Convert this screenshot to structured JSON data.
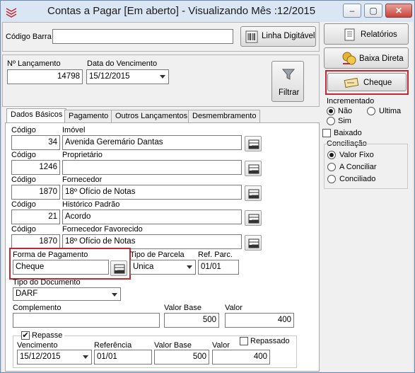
{
  "window": {
    "title": "Contas a Pagar [Em aberto] - Visualizando Mês :12/2015"
  },
  "barcode": {
    "label": "Código Barra",
    "value": "",
    "button": "Linha Digitável"
  },
  "launch": {
    "num_label": "Nº Lançamento",
    "num_value": "14798",
    "due_label": "Data do Vencimento",
    "due_value": "15/12/2015",
    "filter_button": "Filtrar"
  },
  "side": {
    "reports_button": "Relatórios",
    "direct_button": "Baixa Direta",
    "cheque_button": "Cheque",
    "incremented": {
      "label": "Incrementado",
      "options": [
        "Não",
        "Ultima",
        "Sim"
      ],
      "selected": "Não"
    },
    "baixado_label": "Baixado",
    "conciliation": {
      "label": "Conciliação",
      "options": [
        "Valor Fixo",
        "A Conciliar",
        "Conciliado"
      ],
      "selected": "Valor Fixo"
    }
  },
  "tabs": [
    "Dados Básicos",
    "Pagamento",
    "Outros Lançamentos",
    "Desmembramento"
  ],
  "active_tab": "Dados Básicos",
  "basic": {
    "code_label": "Código",
    "rows": [
      {
        "code": "34",
        "name_label": "Imóvel",
        "name": "Avenida Geremário Dantas"
      },
      {
        "code": "1246",
        "name_label": "Proprietário",
        "name": ""
      },
      {
        "code": "1870",
        "name_label": "Fornecedor",
        "name": "18º Ofício de Notas"
      },
      {
        "code": "21",
        "name_label": "Histórico Padrão",
        "name": "Acordo"
      },
      {
        "code": "1870",
        "name_label": "Fornecedor Favorecido",
        "name": "18º Ofício de Notas"
      }
    ],
    "payment_form_label": "Forma de Pagamento",
    "payment_form_value": "Cheque",
    "parcel_type_label": "Tipo de Parcela",
    "parcel_type_value": "Unica",
    "ref_parc_label": "Ref. Parc.",
    "ref_parc_value": "01/01",
    "doc_type_label": "Tipo do Documento",
    "doc_type_value": "DARF",
    "complement_label": "Complemento",
    "complement_value": "",
    "base_value_label": "Valor Base",
    "base_value": "500",
    "value_label": "Valor",
    "value": "400"
  },
  "repasse": {
    "label": "Repasse",
    "checked": true,
    "due_label": "Vencimento",
    "due_value": "15/12/2015",
    "ref_label": "Referência",
    "ref_value": "01/01",
    "base_label": "Valor Base",
    "base_value": "500",
    "value_label": "Valor",
    "value": "400",
    "repassado_label": "Repassado"
  },
  "colors": {
    "highlight": "#c3272f",
    "titlebar": "#dbe6f4"
  }
}
